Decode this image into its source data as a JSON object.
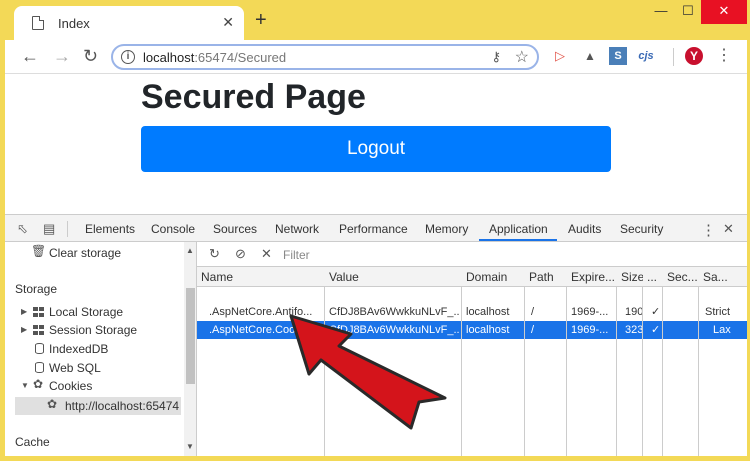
{
  "tab": {
    "title": "Index",
    "close": "✕",
    "new": "+"
  },
  "window_controls": {
    "minimize": "—",
    "maximize": "☐",
    "close": "✕"
  },
  "nav": {
    "back": "←",
    "forward": "→",
    "reload": "↻"
  },
  "omnibox": {
    "host": "localhost",
    "rest": ":65474/Secured",
    "info": "i",
    "key": "⚷",
    "star": "☆"
  },
  "extensions": {
    "ext3_label": "cjs",
    "profile": "Y",
    "menu": "⋮"
  },
  "page": {
    "heading": "Secured Page",
    "logout_label": "Logout"
  },
  "devtools": {
    "tabs": [
      "Elements",
      "Console",
      "Sources",
      "Network",
      "Performance",
      "Memory",
      "Application",
      "Audits",
      "Security"
    ],
    "active_tab": "Application",
    "more": "⋮",
    "close": "✕"
  },
  "sidebar": {
    "clear_storage": "Clear storage",
    "storage_header": "Storage",
    "local_storage": "Local Storage",
    "session_storage": "Session Storage",
    "indexeddb": "IndexedDB",
    "web_sql": "Web SQL",
    "cookies": "Cookies",
    "cookie_origin": "http://localhost:65474",
    "cache_header": "Cache"
  },
  "cookies": {
    "filter_placeholder": "Filter",
    "columns": [
      "Name",
      "Value",
      "Domain",
      "Path",
      "Expire...",
      "Size",
      "...",
      "Sec...",
      "Sa..."
    ],
    "rows": [
      {
        "name": ".AspNetCore.Antifo...",
        "value": "CfDJ8BAv6WwkkuNLvF_...",
        "domain": "localhost",
        "path": "/",
        "expires": "1969-...",
        "size": "190",
        "httponly": "✓",
        "secure": "",
        "samesite": "Strict"
      },
      {
        "name": ".AspNetCore.Cookies",
        "value": "CfDJ8BAv6WwkkuNLvF_...",
        "domain": "localhost",
        "path": "/",
        "expires": "1969-...",
        "size": "323",
        "httponly": "✓",
        "secure": "",
        "samesite": "Lax"
      }
    ],
    "selected_row": 1
  },
  "colors": {
    "accent": "#1a73e8",
    "logout": "#007bff",
    "arrow": "#d4141b",
    "frame": "#f3d957"
  },
  "annotation": {
    "icon": "pointer-arrow"
  }
}
